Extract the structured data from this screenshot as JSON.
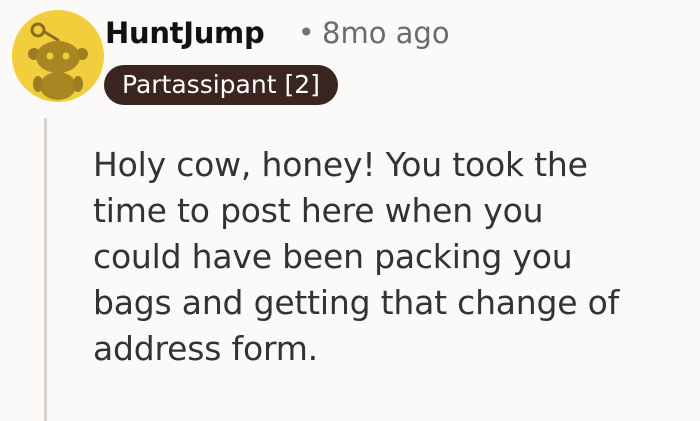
{
  "comment": {
    "username": "HuntJump",
    "separator": "•",
    "timestamp": "8mo ago",
    "flair": "Partassipant [2]",
    "body": "Holy cow, honey! You took the\ntime to post here when you\ncould have been packing you\nbags and getting that change of\naddress form.",
    "avatar_icon": "snoo-avatar-icon"
  },
  "colors": {
    "background": "#fbfaf8",
    "avatar_bg": "#f2cd3c",
    "flair_bg": "#3a2520",
    "thread_line": "#d9d3ce"
  }
}
